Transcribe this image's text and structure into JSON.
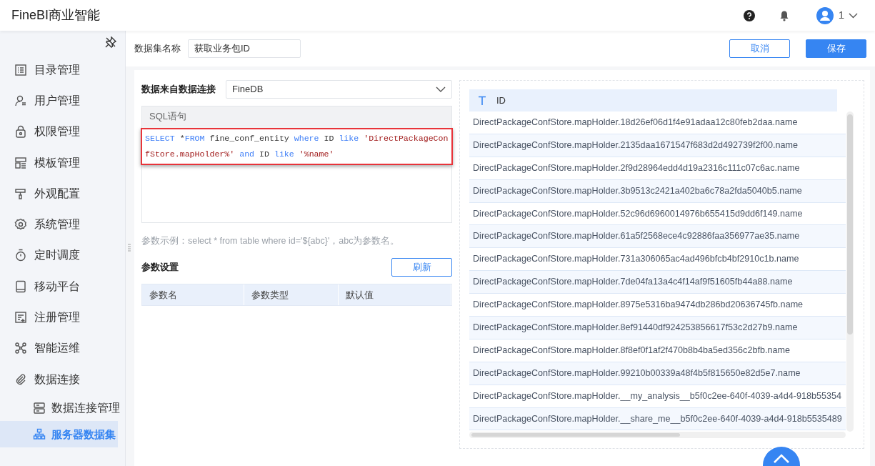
{
  "app": {
    "title": "FineBI商业智能",
    "user": "1"
  },
  "sidebar": {
    "items": [
      {
        "label": "目录管理",
        "selected": false
      },
      {
        "label": "用户管理",
        "selected": false
      },
      {
        "label": "权限管理",
        "selected": false
      },
      {
        "label": "模板管理",
        "selected": false
      },
      {
        "label": "外观配置",
        "selected": false
      },
      {
        "label": "系统管理",
        "selected": false
      },
      {
        "label": "定时调度",
        "selected": false
      },
      {
        "label": "移动平台",
        "selected": false
      },
      {
        "label": "注册管理",
        "selected": false
      },
      {
        "label": "智能运维",
        "selected": false
      },
      {
        "label": "数据连接",
        "selected": false,
        "children": [
          {
            "label": "数据连接管理",
            "selected": false
          },
          {
            "label": "服务器数据集",
            "selected": true
          }
        ]
      }
    ]
  },
  "dataset": {
    "name_label": "数据集名称",
    "name_value": "获取业务包ID"
  },
  "buttons": [
    {
      "label": "取消",
      "kind": "secondary"
    },
    {
      "label": "保存",
      "kind": "primary"
    }
  ],
  "connection": {
    "label": "数据来自数据连接",
    "value": "FineDB"
  },
  "sql": {
    "header": "SQL语句",
    "tokens": [
      {
        "text": "SELECT",
        "kind": "keyword"
      },
      {
        "text": " *",
        "kind": "plain"
      },
      {
        "text": "FROM",
        "kind": "keyword"
      },
      {
        "text": " fine_conf_entity ",
        "kind": "plain"
      },
      {
        "text": "where",
        "kind": "keyword"
      },
      {
        "text": " ID ",
        "kind": "plain"
      },
      {
        "text": "like",
        "kind": "keyword"
      },
      {
        "text": " 'DirectPackageConfStore.mapHolder%'",
        "kind": "string"
      },
      {
        "text": " and",
        "kind": "keyword"
      },
      {
        "text": " ID ",
        "kind": "plain"
      },
      {
        "text": "like",
        "kind": "keyword"
      },
      {
        "text": " '%name'",
        "kind": "string"
      }
    ],
    "hint": "参数示例：select * from table where id='${abc}'，abc为参数名。"
  },
  "params": {
    "title": "参数设置",
    "refresh": "刷新",
    "columns": [
      "参数名",
      "参数类型",
      "默认值"
    ]
  },
  "result": {
    "columns": [
      "ID"
    ],
    "rows": [
      "DirectPackageConfStore.mapHolder.18d26ef06d1f4e91adaa12c80feb2daa.name",
      "DirectPackageConfStore.mapHolder.2135daa1671547f683d2d492739f2f00.name",
      "DirectPackageConfStore.mapHolder.2f9d28964edd4d19a2316c111c07c6ac.name",
      "DirectPackageConfStore.mapHolder.3b9513c2421a402ba6c78a2fda5040b5.name",
      "DirectPackageConfStore.mapHolder.52c96d6960014976b655415d9dd6f149.name",
      "DirectPackageConfStore.mapHolder.61a5f2568ece4c92886faa356977ae35.name",
      "DirectPackageConfStore.mapHolder.731a306065ac4ad496bfcb4bf2910c1b.name",
      "DirectPackageConfStore.mapHolder.7de04fa13a4c4f14af9f51605fb44a88.name",
      "DirectPackageConfStore.mapHolder.8975e5316ba9474db286bd20636745fb.name",
      "DirectPackageConfStore.mapHolder.8ef91440df924253856617f53c2d27b9.name",
      "DirectPackageConfStore.mapHolder.8f8ef0f1af2f470b8b4ba5ed356c2bfb.name",
      "DirectPackageConfStore.mapHolder.99210b00339a48f4b5f815650e82d5e7.name",
      "DirectPackageConfStore.mapHolder.__my_analysis__b5f0c2ee-640f-4039-a4d4-918b55354",
      "DirectPackageConfStore.mapHolder.__share_me__b5f0c2ee-640f-4039-a4d4-918b5535489"
    ]
  }
}
